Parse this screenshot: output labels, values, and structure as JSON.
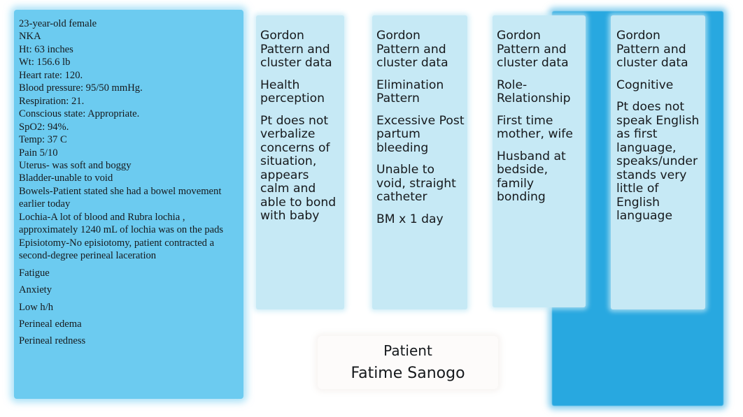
{
  "colors": {
    "accent_rect": "#28a8e0",
    "assessment_panel": "#6ccbf0",
    "card": "#c6e9f5",
    "patient_box": "#fdfbfa",
    "text": "#16191c"
  },
  "assessment": {
    "lines": [
      {
        "text": "23-year-old female",
        "spaced": false
      },
      {
        "text": "NKA",
        "spaced": false
      },
      {
        "text": "Ht: 63 inches",
        "spaced": false
      },
      {
        "text": "Wt: 156.6 lb",
        "spaced": false
      },
      {
        "text": "Heart rate: 120.",
        "spaced": false
      },
      {
        "text": "Blood pressure: 95/50 mmHg.",
        "spaced": false
      },
      {
        "text": "Respiration: 21.",
        "spaced": false
      },
      {
        "text": "Conscious state: Appropriate.",
        "spaced": false
      },
      {
        "text": "SpO2: 94%.",
        "spaced": false
      },
      {
        "text": "Temp: 37 C",
        "spaced": false
      },
      {
        "text": "Pain 5/10",
        "spaced": false
      },
      {
        "text": "Uterus- was soft and boggy",
        "spaced": false
      },
      {
        "text": "Bladder-unable to void",
        "spaced": false
      },
      {
        "text": "Bowels-Patient stated she had a bowel movement earlier today",
        "spaced": false
      },
      {
        "text": "Lochia-A lot of blood and Rubra lochia , approximately 1240 mL of lochia was on the pads",
        "spaced": false
      },
      {
        "text": "Episiotomy-No episiotomy, patient contracted a second-degree perineal laceration",
        "spaced": false
      },
      {
        "text": "Fatigue",
        "spaced": true
      },
      {
        "text": "Anxiety",
        "spaced": true
      },
      {
        "text": "Low h/h",
        "spaced": true
      },
      {
        "text": "Perineal edema",
        "spaced": true
      },
      {
        "text": "Perineal redness",
        "spaced": true
      }
    ]
  },
  "cards": [
    {
      "id": "health",
      "heading": "Gordon Pattern and cluster data",
      "pattern": "Health perception",
      "blocks": [
        "Pt does not verbalize concerns of situation, appears calm and able to bond with baby"
      ]
    },
    {
      "id": "elimination",
      "heading": "Gordon Pattern and cluster data",
      "pattern": "Elimination Pattern",
      "blocks": [
        "Excessive Post partum bleeding",
        "Unable to void, straight catheter",
        "BM x 1 day"
      ]
    },
    {
      "id": "role",
      "heading": "Gordon Pattern and cluster data",
      "pattern": "Role-Relationship",
      "blocks": [
        "First time mother, wife",
        "Husband at bedside, family bonding"
      ]
    },
    {
      "id": "cognitive",
      "heading": "Gordon Pattern and cluster data",
      "pattern": "Cognitive",
      "blocks": [
        "Pt does not speak English as first language, speaks/understands very little of English language"
      ]
    }
  ],
  "patient": {
    "title": "Patient",
    "name": "Fatime Sanogo"
  }
}
